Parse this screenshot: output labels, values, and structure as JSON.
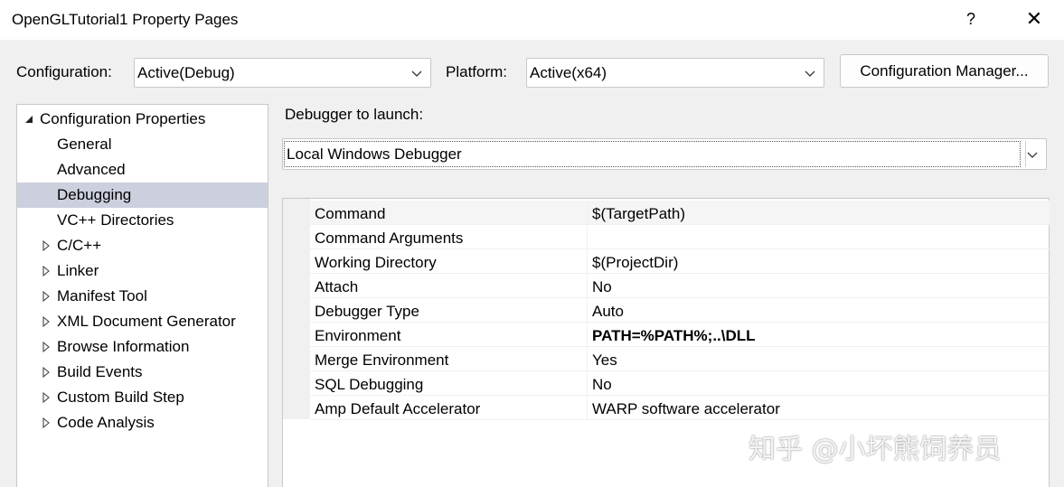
{
  "window": {
    "title": "OpenGLTutorial1 Property Pages",
    "help_glyph": "?",
    "close_glyph": "✕"
  },
  "toolbar": {
    "configuration_label": "Configuration:",
    "configuration_value": "Active(Debug)",
    "platform_label": "Platform:",
    "platform_value": "Active(x64)",
    "config_manager_label": "Configuration Manager..."
  },
  "tree": {
    "root": "Configuration Properties",
    "items": [
      {
        "label": "General",
        "expandable": false
      },
      {
        "label": "Advanced",
        "expandable": false
      },
      {
        "label": "Debugging",
        "expandable": false,
        "selected": true
      },
      {
        "label": "VC++ Directories",
        "expandable": false
      },
      {
        "label": "C/C++",
        "expandable": true
      },
      {
        "label": "Linker",
        "expandable": true
      },
      {
        "label": "Manifest Tool",
        "expandable": true
      },
      {
        "label": "XML Document Generator",
        "expandable": true
      },
      {
        "label": "Browse Information",
        "expandable": true
      },
      {
        "label": "Build Events",
        "expandable": true
      },
      {
        "label": "Custom Build Step",
        "expandable": true
      },
      {
        "label": "Code Analysis",
        "expandable": true
      }
    ]
  },
  "debugger": {
    "label": "Debugger to launch:",
    "value": "Local Windows Debugger"
  },
  "properties": [
    {
      "name": "Command",
      "value": "$(TargetPath)"
    },
    {
      "name": "Command Arguments",
      "value": ""
    },
    {
      "name": "Working Directory",
      "value": "$(ProjectDir)"
    },
    {
      "name": "Attach",
      "value": "No"
    },
    {
      "name": "Debugger Type",
      "value": "Auto"
    },
    {
      "name": "Environment",
      "value": "PATH=%PATH%;..\\DLL",
      "bold": true
    },
    {
      "name": "Merge Environment",
      "value": "Yes"
    },
    {
      "name": "SQL Debugging",
      "value": "No"
    },
    {
      "name": "Amp Default Accelerator",
      "value": "WARP software accelerator"
    }
  ],
  "watermark": "知乎 @小坏熊饲养员",
  "colors": {
    "selection": "#ccd0de",
    "window_bg": "#f0f0f0",
    "border": "#c8c8c8"
  }
}
